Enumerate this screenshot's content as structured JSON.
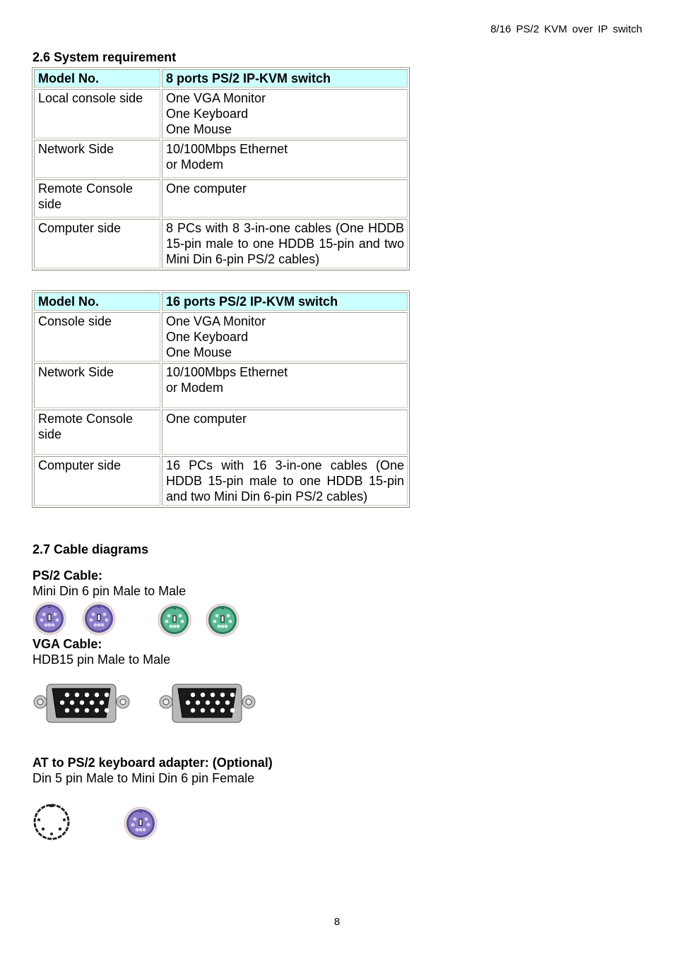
{
  "page_header": "8/16 PS/2 KVM over IP switch",
  "section_system": {
    "title": "2.6 System requirement",
    "tables": [
      {
        "header": [
          "Model No.",
          "8 ports PS/2 IP-KVM switch"
        ],
        "rows": [
          {
            "label": "Local console side",
            "lines": [
              "One VGA Monitor",
              "One Keyboard",
              "One Mouse"
            ]
          },
          {
            "label": "Network Side",
            "lines": [
              "10/100Mbps Ethernet",
              "or Modem"
            ]
          },
          {
            "label": "Remote Console side",
            "lines": [
              "One computer"
            ]
          },
          {
            "label": "Computer side",
            "text": "8 PCs with 8 3-in-one cables (One HDDB 15-pin male to one HDDB 15-pin and two Mini Din 6-pin PS/2 cables)"
          }
        ]
      },
      {
        "header": [
          "Model No.",
          "16 ports PS/2 IP-KVM switch"
        ],
        "rows": [
          {
            "label": "Console side",
            "lines": [
              "One VGA Monitor",
              "One Keyboard",
              "One Mouse"
            ]
          },
          {
            "label": "Network Side",
            "lines": [
              "10/100Mbps Ethernet",
              "or Modem"
            ]
          },
          {
            "label": "Remote Console side",
            "lines": [
              "One computer"
            ]
          },
          {
            "label": "Computer side",
            "text": "16 PCs with 16 3-in-one cables (One HDDB 15-pin male to one HDDB 15-pin and two Mini Din 6-pin PS/2 cables)"
          }
        ]
      }
    ]
  },
  "section_cables": {
    "title": "2.7 Cable diagrams",
    "ps2": {
      "title": "PS/2 Cable:",
      "desc": "Mini Din 6 pin Male to Male",
      "icons": [
        "ps2-purple-connector",
        "ps2-purple-connector",
        "ps2-green-connector",
        "ps2-green-connector"
      ]
    },
    "vga": {
      "title": "VGA Cable:",
      "desc": "HDB15 pin Male to Male",
      "icons": [
        "vga-connector",
        "vga-connector"
      ]
    },
    "at": {
      "title": "AT to PS/2 keyboard adapter: (Optional)",
      "desc": "Din 5 pin Male to Mini Din 6 pin Female",
      "icons": [
        "din5-connector",
        "ps2-purple-connector"
      ]
    }
  },
  "colors": {
    "table_header_bg": "#ccffff",
    "ps2_purple": "#7a6cb8",
    "ps2_green": "#3d9a78"
  },
  "page_number": "8"
}
